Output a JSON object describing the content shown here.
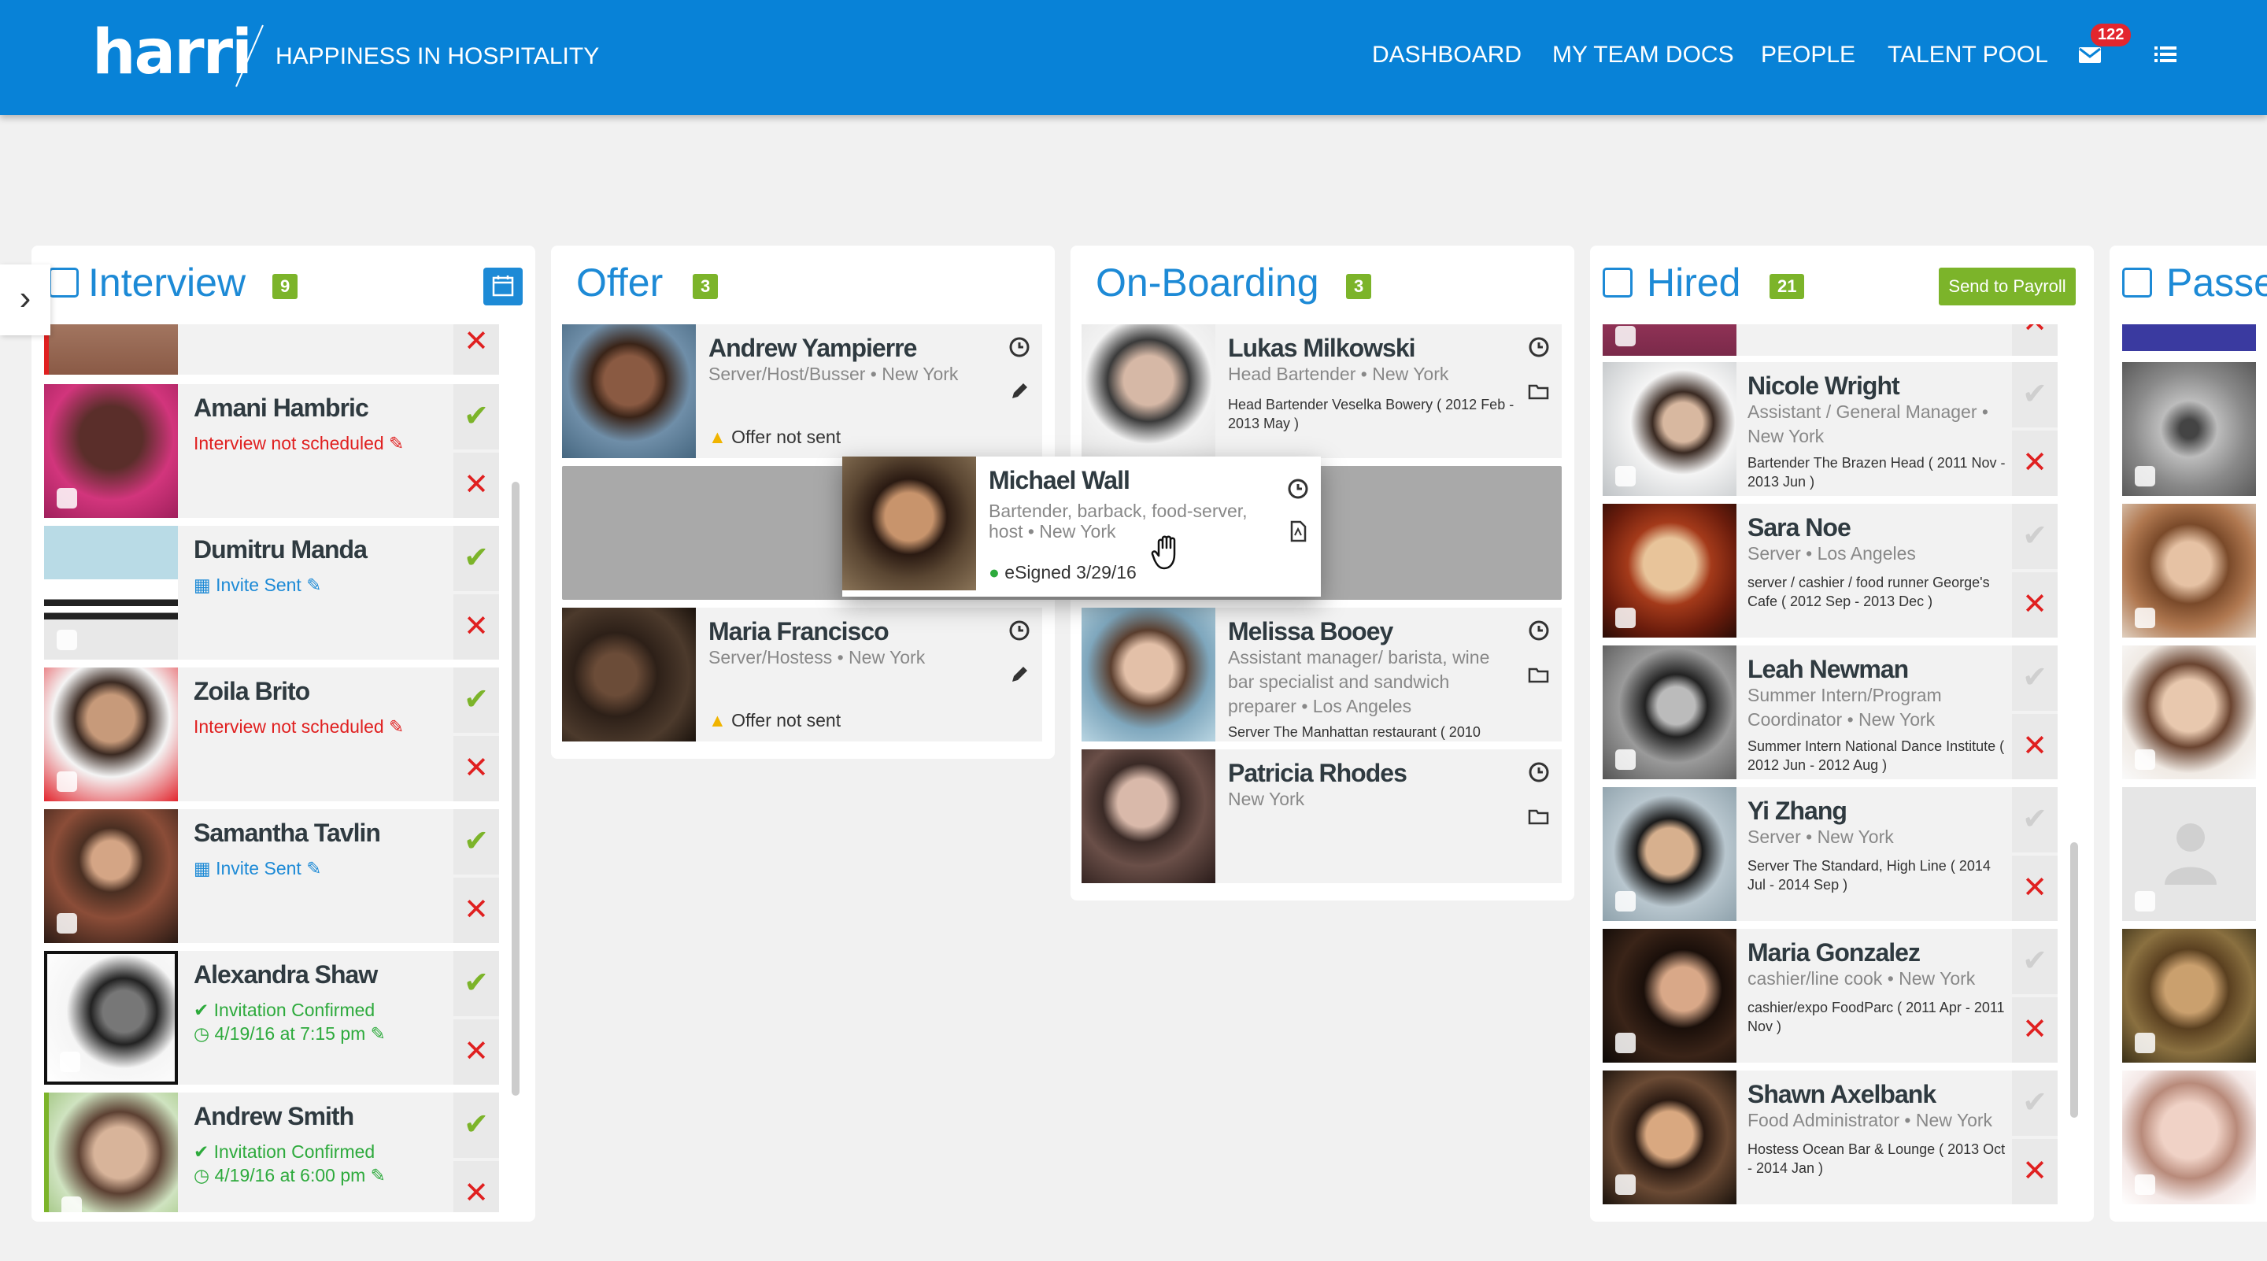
{
  "header": {
    "logo": "harri",
    "tagline": "HAPPINESS IN HOSPITALITY",
    "nav": [
      "DASHBOARD",
      "MY TEAM DOCS",
      "PEOPLE",
      "TALENT POOL"
    ],
    "mail_badge": "122",
    "icons": [
      "mail-icon",
      "list-menu-icon"
    ]
  },
  "interview": {
    "title": "Interview",
    "count": "9",
    "cards": [
      {
        "name": "Amani Hambric",
        "status": "Interview not scheduled",
        "status2": ""
      },
      {
        "name": "Dumitru Manda",
        "status": "Invite Sent",
        "status2": ""
      },
      {
        "name": "Zoila Brito",
        "status": "Interview not scheduled",
        "status2": ""
      },
      {
        "name": "Samantha Tavlin",
        "status": "Invite Sent",
        "status2": ""
      },
      {
        "name": "Alexandra Shaw",
        "status": "Invitation Confirmed",
        "status2": "4/19/16 at 7:15 pm"
      },
      {
        "name": "Andrew Smith",
        "status": "Invitation Confirmed",
        "status2": "4/19/16 at 6:00 pm"
      }
    ]
  },
  "offer": {
    "title": "Offer",
    "count": "3",
    "cards": [
      {
        "name": "Andrew Yampierre",
        "role": "Server/Host/Busser • New York",
        "status": "Offer not sent"
      },
      {
        "name": "Maria Francisco",
        "role": "Server/Hostess • New York",
        "status": "Offer not sent"
      }
    ]
  },
  "dragging": {
    "name": "Michael Wall",
    "role": "Bartender, barback, food-server, host • New York",
    "status": "eSigned 3/29/16"
  },
  "onboarding": {
    "title": "On-Boarding",
    "count": "3",
    "cards": [
      {
        "name": "Lukas Milkowski",
        "role": "Head Bartender • New York",
        "history": "Head Bartender Veselka Bowery ( 2012 Feb - 2013 May )"
      },
      {
        "name": "Melissa Booey",
        "role": "Assistant manager/ barista, wine bar specialist and sandwich preparer • Los Angeles",
        "history": "Server The Manhattan restaurant ( 2010"
      },
      {
        "name": "Patricia Rhodes",
        "role": "New York",
        "history": ""
      }
    ]
  },
  "hired": {
    "title": "Hired",
    "count": "21",
    "send_label": "Send to Payroll",
    "cards": [
      {
        "name": "Nicole Wright",
        "role": "Assistant / General Manager • New York",
        "history": "Bartender The Brazen Head ( 2011 Nov - 2013 Jun )"
      },
      {
        "name": "Sara Noe",
        "role": "Server • Los Angeles",
        "history": "server / cashier / food runner George's Cafe ( 2012 Sep - 2013 Dec )"
      },
      {
        "name": "Leah Newman",
        "role": "Summer Intern/Program Coordinator • New York",
        "history": "Summer Intern National Dance Institute ( 2012 Jun - 2012 Aug )"
      },
      {
        "name": "Yi Zhang",
        "role": "Server • New York",
        "history": "Server The Standard, High Line ( 2014 Jul - 2014 Sep )"
      },
      {
        "name": "Maria Gonzalez",
        "role": "cashier/line cook • New York",
        "history": "cashier/expo FoodParc ( 2011 Apr - 2011 Nov )"
      },
      {
        "name": "Shawn Axelbank",
        "role": "Food Administrator • New York",
        "history": "Hostess Ocean Bar & Lounge ( 2013 Oct - 2014 Jan )"
      }
    ]
  },
  "passed": {
    "title": "Passe"
  },
  "colors": {
    "header": "#0882d7",
    "accent": "#1d8ad6",
    "count_badge": "#7cb42a",
    "error": "#e02020",
    "success": "#2daa3c"
  }
}
